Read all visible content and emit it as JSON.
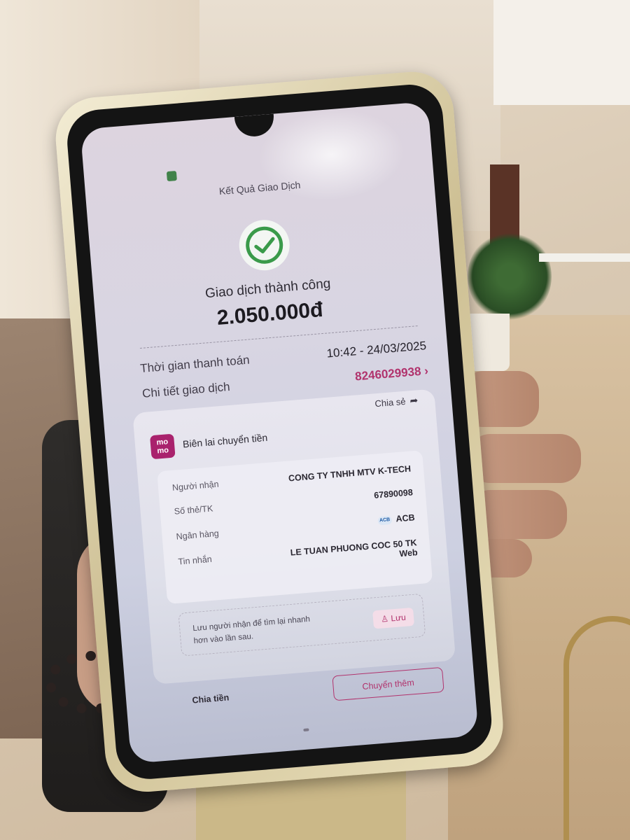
{
  "screen": {
    "header_title": "Kết Quả Giao Dịch",
    "status": "Giao dịch thành công",
    "amount": "2.050.000đ",
    "payment_time_label": "Thời gian thanh toán",
    "payment_time_value": "10:42 - 24/03/2025",
    "detail_label": "Chi tiết giao dịch",
    "detail_value": "8246029938",
    "detail_chevron": "›",
    "share_label": "Chia sẻ",
    "share_icon": "share-arrow-icon",
    "receipt_title": "Biên lai chuyển tiền",
    "logo_text_1": "mo",
    "logo_text_2": "mo",
    "recipient_label": "Người nhận",
    "recipient_value": "CONG TY TNHH MTV K-TECH",
    "account_label": "Số thẻ/TK",
    "account_value": "67890098",
    "bank_label": "Ngân hàng",
    "bank_badge": "ACB",
    "bank_value": "ACB",
    "message_label": "Tin nhắn",
    "message_value_1": "LE TUAN PHUONG COC 50 TK",
    "message_value_2": "Web",
    "save_hint": "Lưu người nhận để tìm lại nhanh hơn vào lần sau.",
    "save_button": "Lưu",
    "save_icon": "person-add-icon",
    "split_button": "Chia tiền",
    "transfer_more_button": "Chuyển thêm"
  },
  "colors": {
    "accent_pink": "#b1336d",
    "success_green": "#3a9a4a",
    "momo_brand": "#a9226d"
  }
}
